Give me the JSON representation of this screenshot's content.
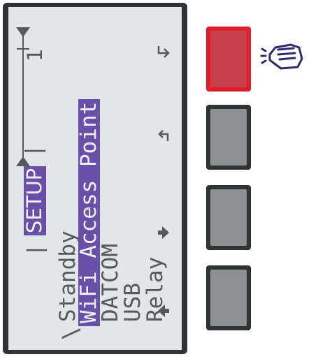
{
  "header": {
    "left_sep": "|",
    "active_tab": "SETUP",
    "right_sep": "|",
    "page_number": "1"
  },
  "menu": {
    "items": [
      "Standby",
      "WiFi Access Point",
      "DATCOM",
      "USB",
      "Relay"
    ],
    "selected_index": 1
  },
  "nav_icons": [
    "enter-icon",
    "back-icon",
    "arrow-down-icon",
    "arrow-up-icon"
  ],
  "keys": [
    {
      "icon": "enter-key",
      "active": true
    },
    {
      "icon": "back-key",
      "active": false
    },
    {
      "icon": "down-key",
      "active": false
    },
    {
      "icon": "up-key",
      "active": false
    }
  ],
  "colors": {
    "lcd_background": "#e3e6e8",
    "lcd_text": "#55595c",
    "selection": "#6a4fa8",
    "active_key": "#e01d2c",
    "inactive_key": "#8d8f90",
    "hand_icon": "#2e2a6e"
  }
}
